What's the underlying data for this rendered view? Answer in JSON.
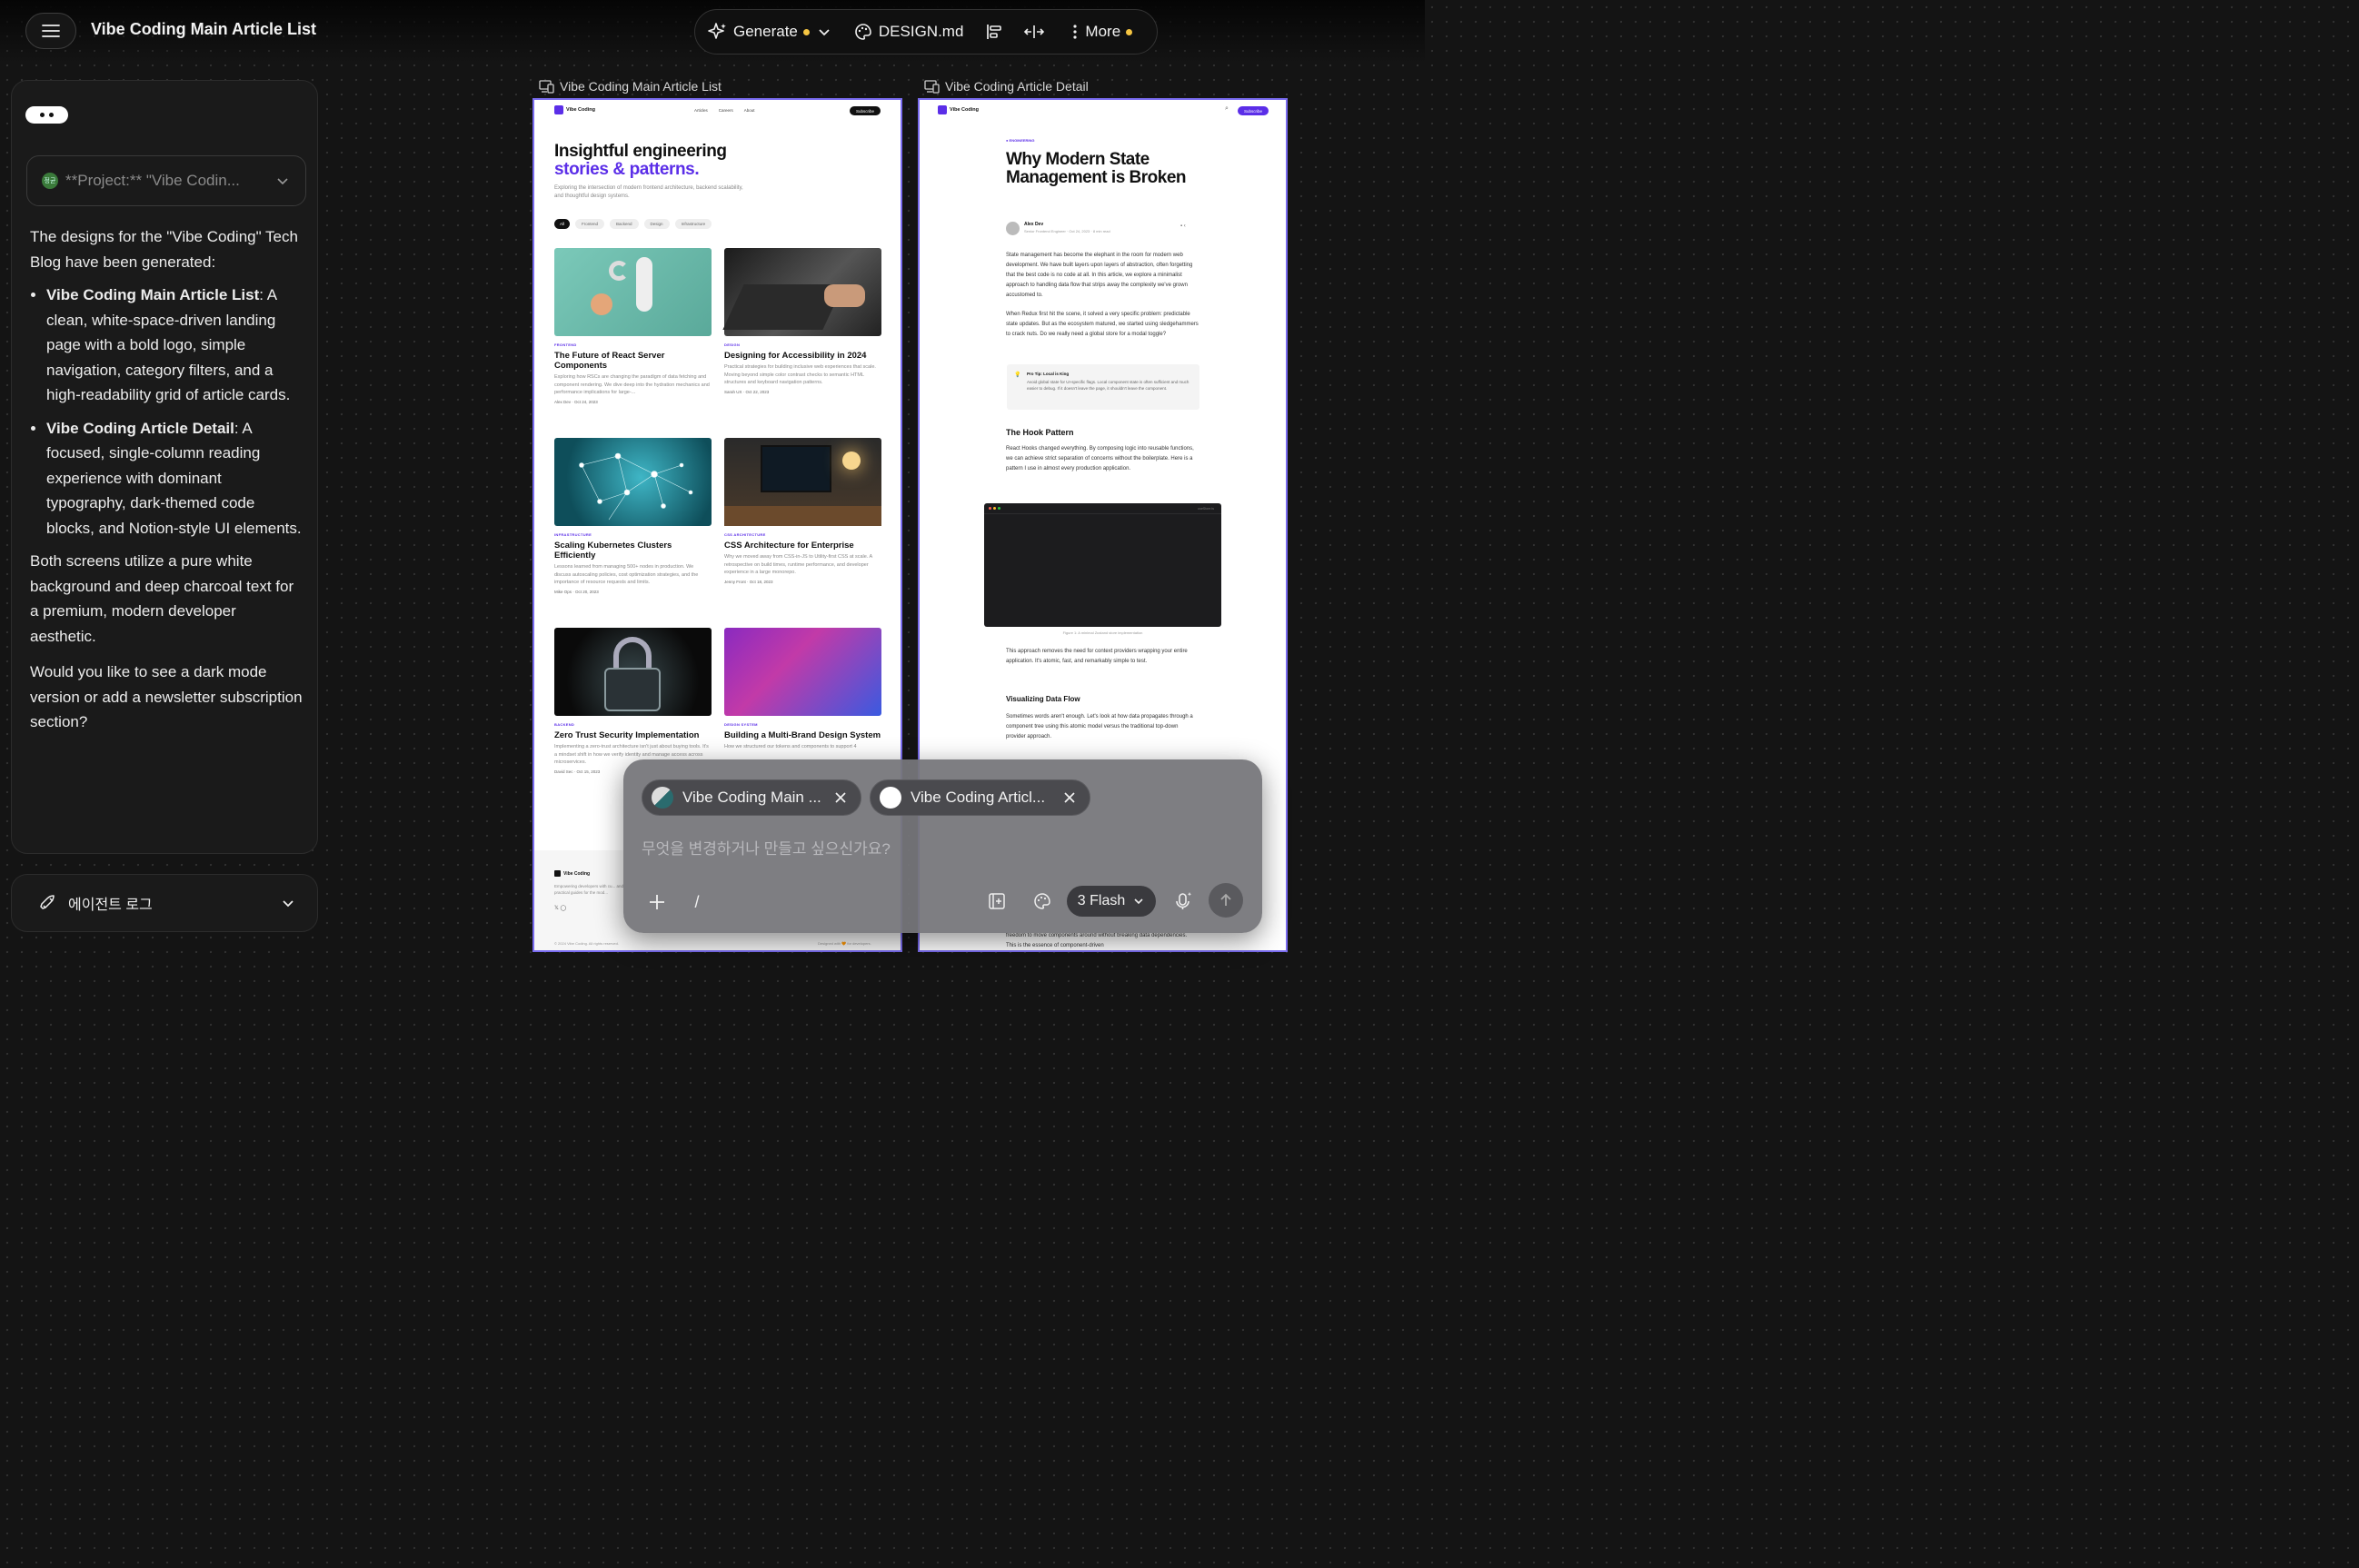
{
  "header": {
    "title": "Vibe Coding Main Article List",
    "toolbar": {
      "generate_label": "Generate",
      "design_label": "DESIGN.md",
      "more_label": "More",
      "accent": "#f5c542"
    }
  },
  "sidebar": {
    "project_label": "**Project:** \"Vibe Codin...",
    "project_avatar": "정균",
    "message": {
      "intro": "The designs for the \"Vibe Coding\" Tech Blog have been generated:",
      "items": [
        {
          "title": "Vibe Coding Main Article List",
          "text": ": A clean, white-space-driven landing page with a bold logo, simple navigation, category filters, and a high-readability grid of article cards."
        },
        {
          "title": "Vibe Coding Article Detail",
          "text": ": A focused, single-column reading experience with dominant typography, dark-themed code blocks, and Notion-style UI elements."
        }
      ],
      "para2": "Both screens utilize a pure white background and deep charcoal text for a premium, modern developer aesthetic.",
      "para3": "Would you like to see a dark mode version or add a newsletter subscription section?"
    },
    "agent_log_label": "에이전트 로그"
  },
  "canvas": {
    "frame1": {
      "label": "Vibe Coding Main Article List",
      "logo": "Vibe Coding",
      "nav": [
        "Articles",
        "Careers",
        "About"
      ],
      "subscribe": "Subscribe",
      "hero_line1": "Insightful engineering",
      "hero_line2": "stories & patterns.",
      "hero_desc": "Exploring the intersection of modern frontend architecture, backend scalability, and thoughtful design systems.",
      "filters": [
        "All",
        "Frontend",
        "Backend",
        "Design",
        "Infrastructure"
      ],
      "cards": [
        {
          "cat": "FRONTEND",
          "title": "The Future of React Server Components",
          "desc": "Exploring how RSCs are changing the paradigm of data fetching and component rendering. We dive deep into the hydration mechanics and performance implications for large-...",
          "meta": "Alex Dev  ·  Oct 24, 2023"
        },
        {
          "cat": "DESIGN",
          "title": "Designing for Accessibility in 2024",
          "desc": "Practical strategies for building inclusive web experiences that scale. Moving beyond simple color contrast checks to semantic HTML structures and keyboard navigation patterns.",
          "meta": "Sarah UX  ·  Oct 22, 2023"
        },
        {
          "cat": "INFRASTRUCTURE",
          "title": "Scaling Kubernetes Clusters Efficiently",
          "desc": "Lessons learned from managing 500+ nodes in production. We discuss autoscaling policies, cost optimization strategies, and the importance of resource requests and limits.",
          "meta": "Mike Ops  ·  Oct 20, 2023"
        },
        {
          "cat": "CSS ARCHITECTURE",
          "title": "CSS Architecture for Enterprise",
          "desc": "Why we moved away from CSS-in-JS to Utility-first CSS at scale. A retrospective on build times, runtime performance, and developer experience in a large monorepo.",
          "meta": "Jenny Front  ·  Oct 18, 2023"
        },
        {
          "cat": "BACKEND",
          "title": "Zero Trust Security Implementation",
          "desc": "Implementing a zero-trust architecture isn't just about buying tools. It's a mindset shift in how we verify identity and manage access across microservices.",
          "meta": "David Sec  ·  Oct 15, 2023"
        },
        {
          "cat": "DESIGN SYSTEM",
          "title": "Building a Multi-Brand Design System",
          "desc": "How we structured our tokens and components to support 4",
          "meta": ""
        }
      ],
      "footer_logo": "Vibe Coding",
      "footer_desc": "Empowering developers with cu... and practical guides for the mod...",
      "footer_copy": "© 2024 Vibe Coding. All rights reserved.",
      "footer_right": "Designed with 🧡 for developers."
    },
    "frame2": {
      "label": "Vibe Coding Article Detail",
      "logo": "Vibe Coding",
      "subscribe": "Subscribe",
      "tag": "● ENGINEERING",
      "title": "Why Modern State Management is Broken",
      "author": "Alex Dev",
      "author_meta": "Senior Frontend Engineer  ·  Oct 24, 2023  ·  8 min read",
      "p1": "State management has become the elephant in the room for modern web development. We have built layers upon layers of abstraction, often forgetting that the best code is no code at all. In this article, we explore a minimalist approach to handling data flow that strips away the complexity we've grown accustomed to.",
      "p2": "When Redux first hit the scene, it solved a very specific problem: predictable state updates. But as the ecosystem matured, we started using sledgehammers to crack nuts. Do we really need a global store for a modal toggle?",
      "tip_title": "Pro Tip: Local is King",
      "tip_text": "Avoid global state for UI-specific flags. Local component state is often sufficient and much easier to debug. If it doesn't leave the page, it shouldn't leave the component.",
      "h2": "The Hook Pattern",
      "p3": "React Hooks changed everything. By composing logic into reusable functions, we can achieve strict separation of concerns without the boilerplate. Here is a pattern I use in almost every production application.",
      "code_file": "useStore.ts",
      "caption": "Figure 1: A minimal Zustand store implementation",
      "p4": "This approach removes the need for context providers wrapping your entire application. It's atomic, fast, and remarkably simple to test.",
      "h3": "Visualizing Data Flow",
      "p5": "Sometimes words aren't enough. Let's look at how data propagates through a component tree using this atomic model versus the traditional top-down provider approach.",
      "p6": "freedom to move components around without breaking data dependencies. This is the essence of component-driven"
    }
  },
  "composer": {
    "chip1": "Vibe Coding Main ...",
    "chip2": "Vibe Coding Articl...",
    "placeholder": "무엇을 변경하거나 만들고 싶으신가요?",
    "slash": "/",
    "model": "3 Flash"
  }
}
